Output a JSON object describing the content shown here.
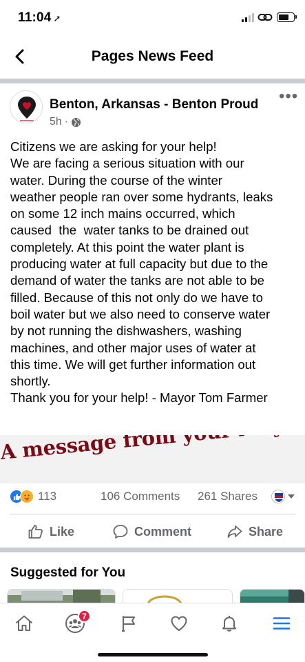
{
  "status_bar": {
    "time": "11:04",
    "location_glyph": "➚",
    "battery_level": 0.75
  },
  "header": {
    "title": "Pages News Feed",
    "back_icon": "chevron-left-icon"
  },
  "post": {
    "page_name": "Benton, Arkansas - Benton Proud",
    "time_ago": "5h",
    "separator": "·",
    "privacy_icon": "globe-icon",
    "more_label": "•••",
    "text_lines": [
      "Citizens we are asking for your help!",
      "We are facing a serious situation with our",
      "water. During the course of the winter",
      "weather people ran over some hydrants, leaks",
      "on some 12 inch mains occurred, which",
      "caused  the  water tanks to be drained out",
      "completely. At this point the water plant is",
      "producing water at full capacity but due to the",
      "demand of water the tanks are not able to be",
      "filled. Because of this not only do we have to",
      "boil water but we also need to conserve water",
      "by not running the dishwashers, washing",
      "machines, and other major uses of water at",
      "this time. We will get further information out",
      "shortly.",
      "Thank you for your help! - Mayor Tom Farmer"
    ],
    "banner_text": "A message from your Mayor...",
    "banner_color": "#7a0b16",
    "reaction_count": "113",
    "comments": "106 Comments",
    "shares": "261 Shares"
  },
  "actions": {
    "like": "Like",
    "comment": "Comment",
    "share": "Share"
  },
  "suggested": {
    "title": "Suggested for You"
  },
  "bottom_nav": {
    "items": [
      "home-icon",
      "groups-icon",
      "pages-flag-icon",
      "dating-heart-icon",
      "notifications-bell-icon",
      "menu-icon"
    ],
    "groups_badge": "7"
  },
  "colors": {
    "facebook_blue": "#1877f2",
    "secondary_text": "#65676b",
    "badge_red": "#e41e3f"
  }
}
